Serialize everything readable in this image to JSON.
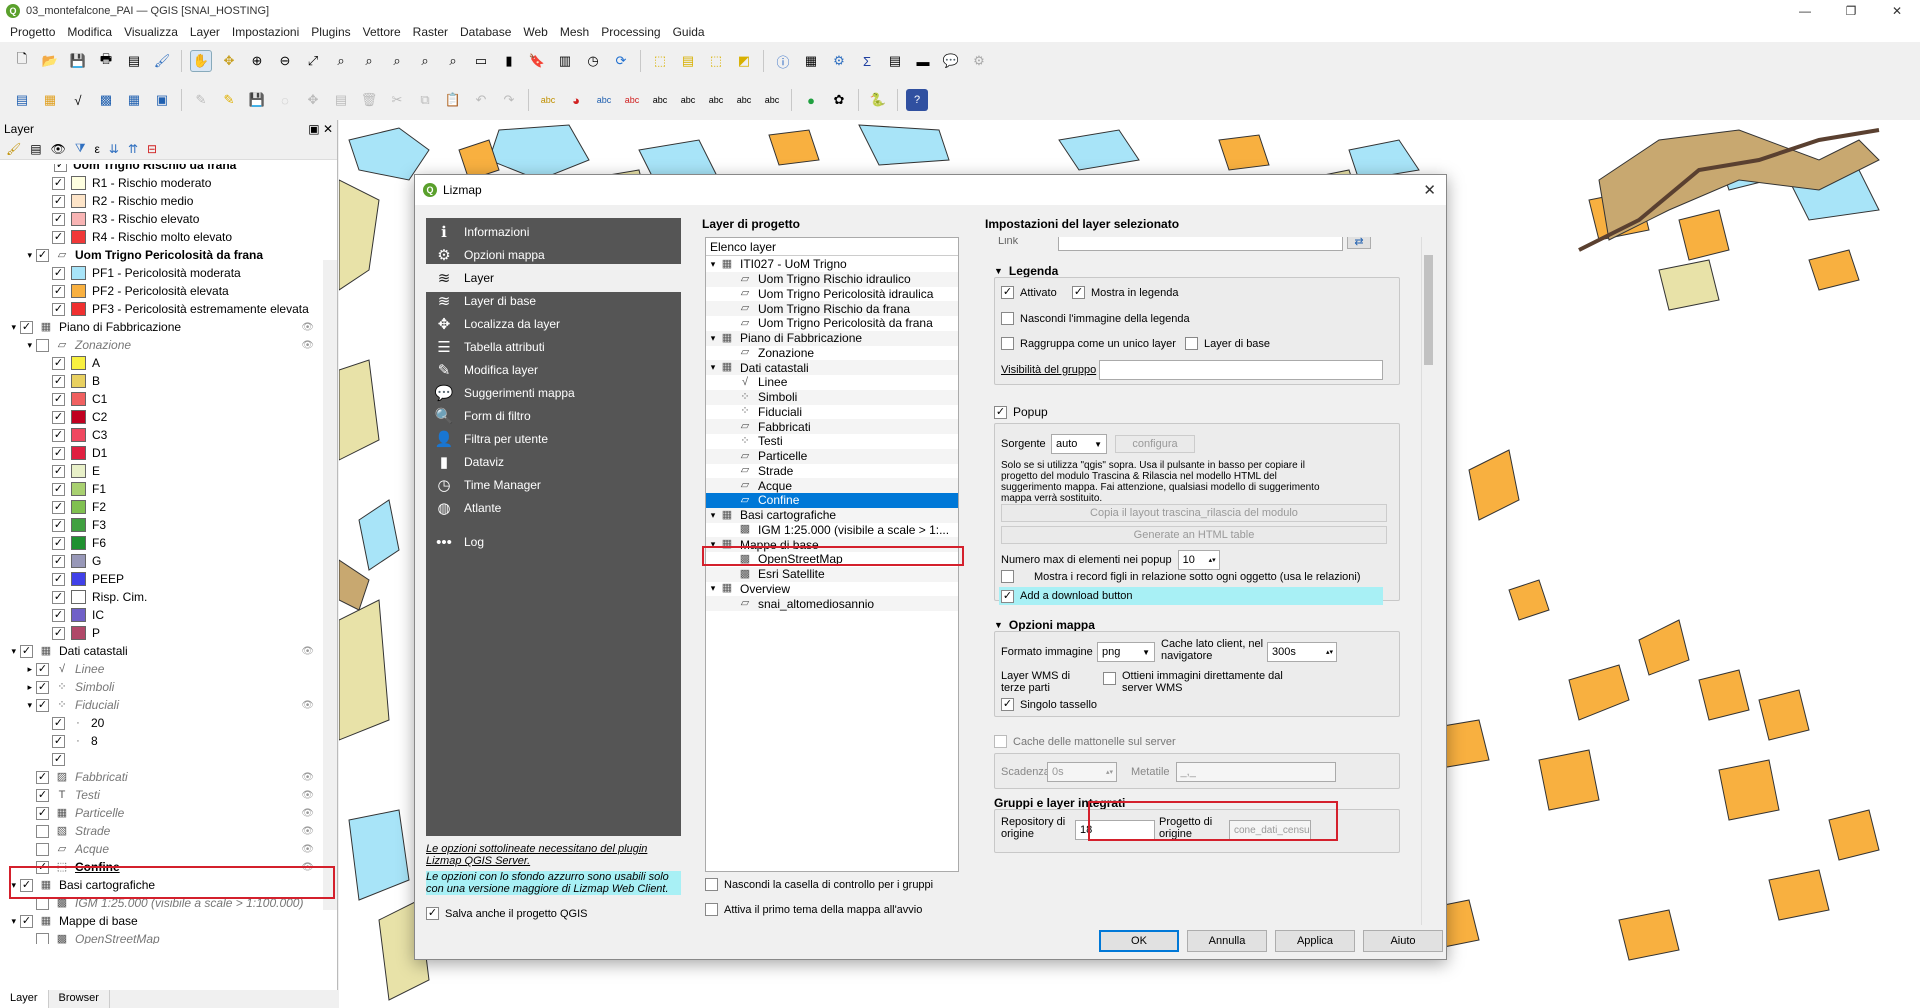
{
  "window": {
    "title": "03_montefalcone_PAI — QGIS [SNAI_HOSTING]",
    "controls": [
      "—",
      "❐",
      "✕"
    ]
  },
  "menu": [
    "Progetto",
    "Modifica",
    "Visualizza",
    "Layer",
    "Impostazioni",
    "Plugins",
    "Vettore",
    "Raster",
    "Database",
    "Web",
    "Mesh",
    "Processing",
    "Guida"
  ],
  "layers_panel": {
    "title": "Layer",
    "tabs": [
      "Layer",
      "Browser"
    ],
    "tree": [
      {
        "indent": 3,
        "check": true,
        "label": "R1 - Rischio moderato",
        "swatch": "#ffffe0"
      },
      {
        "indent": 3,
        "check": true,
        "label": "R2 - Rischio medio",
        "swatch": "#fde4c8"
      },
      {
        "indent": 3,
        "check": true,
        "label": "R3 - Rischio elevato",
        "swatch": "#f8b4b4"
      },
      {
        "indent": 3,
        "check": true,
        "label": "R4 - Rischio molto elevato",
        "swatch": "#f03838"
      },
      {
        "indent": 2,
        "arrow": "▾",
        "check": true,
        "icon": "▱",
        "label": "Uom Trigno Pericolosità da frana",
        "bold": true
      },
      {
        "indent": 3,
        "check": true,
        "label": "PF1 - Pericolosità moderata",
        "swatch": "#a8e4f8"
      },
      {
        "indent": 3,
        "check": true,
        "label": "PF2 - Pericolosità elevata",
        "swatch": "#f8b040"
      },
      {
        "indent": 3,
        "check": true,
        "label": "PF3 - Pericolosità estremamente elevata",
        "swatch": "#f03030"
      },
      {
        "indent": 1,
        "arrow": "▾",
        "check": true,
        "icon": "▦",
        "label": "Piano di Fabbricazione",
        "eye": true
      },
      {
        "indent": 2,
        "arrow": "▾",
        "check": false,
        "icon": "▱",
        "label": "Zonazione",
        "italic": true,
        "eye": true
      },
      {
        "indent": 3,
        "check": true,
        "label": "A",
        "swatch": "#f8f040"
      },
      {
        "indent": 3,
        "check": true,
        "label": "B",
        "swatch": "#e8d060"
      },
      {
        "indent": 3,
        "check": true,
        "label": "C1",
        "swatch": "#f06060"
      },
      {
        "indent": 3,
        "check": true,
        "label": "C2",
        "swatch": "#c00020"
      },
      {
        "indent": 3,
        "check": true,
        "label": "C3",
        "swatch": "#f04860"
      },
      {
        "indent": 3,
        "check": true,
        "label": "D1",
        "swatch": "#e02040"
      },
      {
        "indent": 3,
        "check": true,
        "label": "E",
        "swatch": "#e8f0c8"
      },
      {
        "indent": 3,
        "check": true,
        "label": "F1",
        "swatch": "#a8d070"
      },
      {
        "indent": 3,
        "check": true,
        "label": "F2",
        "swatch": "#80c050"
      },
      {
        "indent": 3,
        "check": true,
        "label": "F3",
        "swatch": "#40a040"
      },
      {
        "indent": 3,
        "check": true,
        "label": "F6",
        "swatch": "#209030"
      },
      {
        "indent": 3,
        "check": true,
        "label": "G",
        "swatch": "#9898b8"
      },
      {
        "indent": 3,
        "check": true,
        "label": "PEEP",
        "swatch": "#4040e8"
      },
      {
        "indent": 3,
        "check": true,
        "label": "Risp. Cim.",
        "swatch": "#ffffff"
      },
      {
        "indent": 3,
        "check": true,
        "label": "IC",
        "swatch": "#7060c8"
      },
      {
        "indent": 3,
        "check": true,
        "label": "P",
        "swatch": "#b04868"
      },
      {
        "indent": 1,
        "arrow": "▾",
        "check": true,
        "icon": "▦",
        "label": "Dati catastali",
        "eye": true
      },
      {
        "indent": 2,
        "arrow": "▸",
        "check": true,
        "icon": "√",
        "label": "Linee",
        "italic": true
      },
      {
        "indent": 2,
        "arrow": "▸",
        "check": true,
        "icon": "⁘",
        "label": "Simboli",
        "italic": true
      },
      {
        "indent": 2,
        "arrow": "▾",
        "check": true,
        "icon": "⁘",
        "label": "Fiduciali",
        "italic": true,
        "eye": true
      },
      {
        "indent": 3,
        "check": true,
        "label": "20",
        "icon": "·"
      },
      {
        "indent": 3,
        "check": true,
        "label": "8",
        "icon": "·"
      },
      {
        "indent": 3,
        "check": true,
        "label": ""
      },
      {
        "indent": 2,
        "check": true,
        "icon": "▨",
        "label": "Fabbricati",
        "italic": true,
        "eye": true
      },
      {
        "indent": 2,
        "check": true,
        "icon": "T",
        "label": "Testi",
        "italic": true,
        "eye": true
      },
      {
        "indent": 2,
        "check": true,
        "icon": "▦",
        "label": "Particelle",
        "italic": true,
        "eye": true
      },
      {
        "indent": 2,
        "check": false,
        "icon": "▧",
        "label": "Strade",
        "italic": true,
        "eye": true
      },
      {
        "indent": 2,
        "check": false,
        "icon": "▱",
        "label": "Acque",
        "italic": true,
        "eye": true
      },
      {
        "indent": 2,
        "check": true,
        "icon": "⬚",
        "label": "Confine",
        "bold": true,
        "underline": true,
        "eye": true
      },
      {
        "indent": 1,
        "arrow": "▾",
        "check": true,
        "icon": "▦",
        "label": "Basi cartografiche"
      },
      {
        "indent": 2,
        "check": false,
        "icon": "▩",
        "label": "IGM 1:25.000 (visibile a scale > 1:100.000)",
        "italic": true
      },
      {
        "indent": 1,
        "arrow": "▾",
        "check": true,
        "icon": "▦",
        "label": "Mappe di base"
      },
      {
        "indent": 2,
        "check": false,
        "icon": "▩",
        "label": "OpenStreetMap",
        "italic": true
      },
      {
        "indent": 2,
        "check": false,
        "icon": "▩",
        "label": "Esri Satellite",
        "italic": true
      }
    ],
    "first_row_partial": "Uom Trigno Rischio da frana"
  },
  "dialog": {
    "title": "Lizmap",
    "nav": [
      {
        "icon": "info-icon",
        "glyph": "ℹ",
        "label": "Informazioni"
      },
      {
        "icon": "settings-icon",
        "glyph": "⚙",
        "label": "Opzioni mappa"
      },
      {
        "icon": "layers-icon",
        "glyph": "≋",
        "label": "Layer",
        "active": true
      },
      {
        "icon": "base-layers-icon",
        "glyph": "≋",
        "label": "Layer di base"
      },
      {
        "icon": "locate-icon",
        "glyph": "✥",
        "label": "Localizza da layer"
      },
      {
        "icon": "table-icon",
        "glyph": "☰",
        "label": "Tabella attributi"
      },
      {
        "icon": "edit-icon",
        "glyph": "✎",
        "label": "Modifica layer"
      },
      {
        "icon": "tooltip-icon",
        "glyph": "💬",
        "label": "Suggerimenti mappa"
      },
      {
        "icon": "search-icon",
        "glyph": "🔍",
        "label": "Form di filtro"
      },
      {
        "icon": "user-icon",
        "glyph": "👤",
        "label": "Filtra per utente"
      },
      {
        "icon": "chart-icon",
        "glyph": "▮",
        "label": "Dataviz"
      },
      {
        "icon": "clock-icon",
        "glyph": "◷",
        "label": "Time Manager"
      },
      {
        "icon": "globe-icon",
        "glyph": "◍",
        "label": "Atlante"
      },
      {
        "icon": "more-icon",
        "glyph": "•••",
        "label": "Log"
      }
    ],
    "note_underlined": "Le opzioni sottolineate necessitano del plugin Lizmap QGIS Server.",
    "note_cyan": "Le opzioni con lo sfondo azzurro sono usabili solo con una versione maggiore di Lizmap Web Client.",
    "save_qgis_label": "Salva anche il progetto QGIS",
    "project_layers": {
      "title": "Layer di progetto",
      "header": "Elenco layer",
      "rows": [
        {
          "indent": 0,
          "arrow": "▾",
          "icon": "▦",
          "label": "ITI027 - UoM Trigno"
        },
        {
          "indent": 1,
          "icon": "▱",
          "label": "Uom Trigno Rischio idraulico"
        },
        {
          "indent": 1,
          "icon": "▱",
          "label": "Uom Trigno Pericolosità idraulica"
        },
        {
          "indent": 1,
          "icon": "▱",
          "label": "Uom Trigno Rischio da frana"
        },
        {
          "indent": 1,
          "icon": "▱",
          "label": "Uom Trigno Pericolosità da frana"
        },
        {
          "indent": 0,
          "arrow": "▾",
          "icon": "▦",
          "label": "Piano di Fabbricazione"
        },
        {
          "indent": 1,
          "icon": "▱",
          "label": "Zonazione"
        },
        {
          "indent": 0,
          "arrow": "▾",
          "icon": "▦",
          "label": "Dati catastali"
        },
        {
          "indent": 1,
          "icon": "√",
          "label": "Linee"
        },
        {
          "indent": 1,
          "icon": "⁘",
          "label": "Simboli"
        },
        {
          "indent": 1,
          "icon": "⁘",
          "label": "Fiduciali"
        },
        {
          "indent": 1,
          "icon": "▱",
          "label": "Fabbricati"
        },
        {
          "indent": 1,
          "icon": "⁘",
          "label": "Testi"
        },
        {
          "indent": 1,
          "icon": "▱",
          "label": "Particelle"
        },
        {
          "indent": 1,
          "icon": "▱",
          "label": "Strade"
        },
        {
          "indent": 1,
          "icon": "▱",
          "label": "Acque"
        },
        {
          "indent": 1,
          "icon": "▱",
          "label": "Confine",
          "selected": true
        },
        {
          "indent": 0,
          "arrow": "▾",
          "icon": "▦",
          "label": "Basi cartografiche"
        },
        {
          "indent": 1,
          "icon": "▩",
          "label": "IGM 1:25.000 (visibile a scale > 1:..."
        },
        {
          "indent": 0,
          "arrow": "▾",
          "icon": "▦",
          "label": "Mappe di base"
        },
        {
          "indent": 1,
          "icon": "▩",
          "label": "OpenStreetMap"
        },
        {
          "indent": 1,
          "icon": "▩",
          "label": "Esri Satellite"
        },
        {
          "indent": 0,
          "arrow": "▾",
          "icon": "▦",
          "label": "Overview"
        },
        {
          "indent": 1,
          "icon": "▱",
          "label": "snai_altomediosannio"
        }
      ],
      "opt_group_checkbox": "Nascondi la casella di controllo per i gruppi",
      "opt_first_theme": "Attiva il primo tema della mappa all'avvio"
    },
    "settings": {
      "title": "Impostazioni del layer selezionato",
      "link_label": "Link",
      "legend": {
        "title": "Legenda",
        "enabled": "Attivato",
        "show_in_legend": "Mostra in legenda",
        "hide_legend_image": "Nascondi l'immagine della legenda",
        "group_as_layer": "Raggruppa come un unico layer",
        "base_layer": "Layer di base",
        "group_visibility": "Visibilità del gruppo"
      },
      "popup": {
        "title": "Popup",
        "source_label": "Sorgente",
        "source_value": "auto",
        "configure": "configura",
        "description": "Solo se si utilizza \"qgis\" sopra. Usa il pulsante in basso per copiare il progetto del modulo Trascina & Rilascia nel modello HTML del suggerimento mappa. Fai attenzione, qualsiasi modello di suggerimento mappa verrà sostituito.",
        "copy_layout_button": "Copia il layout trascina_rilascia del modulo",
        "generate_html_button": "Generate an HTML table",
        "max_items_label": "Numero max di elementi nei popup",
        "max_items_value": "10",
        "show_children": "Mostra i record figli in relazione sotto ogni oggetto (usa le relazioni)",
        "download_button": "Add a download button"
      },
      "map_options": {
        "title": "Opzioni mappa",
        "image_format_label": "Formato immagine",
        "image_format_value": "png",
        "browser_cache_label": "Cache lato client, nel navigatore",
        "browser_cache_value": "300s",
        "wms_label": "Layer WMS di terze parti",
        "direct_wms": "Ottieni immagini direttamente dal server WMS",
        "single_tile": "Singolo tassello"
      },
      "server_cache": "Cache delle mattonelle sul server",
      "expiration_label": "Scadenza",
      "expiration_value": "0s",
      "metatile_label": "Metatile",
      "metatile_value": "_,_",
      "embedded": {
        "title": "Gruppi e layer integrati",
        "repository_label": "Repository di origine",
        "repository_value": "18",
        "project_label": "Progetto di origine",
        "project_value": "cone_dati_censuari"
      }
    },
    "buttons": {
      "ok": "OK",
      "cancel": "Annulla",
      "apply": "Applica",
      "help": "Aiuto"
    }
  },
  "colors": {
    "accent": "#0078d7",
    "highlight": "#d4202c",
    "nav_bg": "#555555",
    "cyan_note": "#a8f0f5"
  }
}
